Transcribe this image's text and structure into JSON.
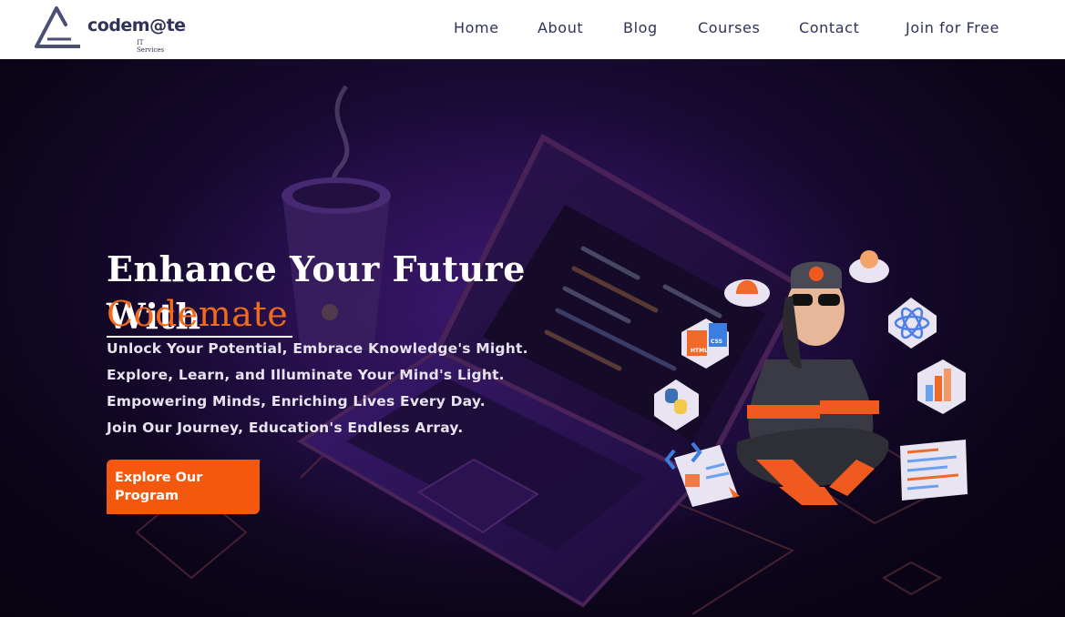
{
  "brand": {
    "name": "codem@te",
    "subtitle": "IT Services",
    "logo_icon": "triangle-logo-icon",
    "color": "#2f3357"
  },
  "nav": {
    "items": [
      {
        "label": "Home"
      },
      {
        "label": "About"
      },
      {
        "label": "Blog"
      },
      {
        "label": "Courses"
      },
      {
        "label": "Contact"
      },
      {
        "label": "Join for Free"
      }
    ]
  },
  "hero": {
    "title_line1": "Enhance Your Future With",
    "title_accent": "Codemate",
    "taglines": [
      "Unlock Your Potential, Embrace Knowledge's Might.",
      "Explore, Learn, and Illuminate Your Mind's Light.",
      "Empowering Minds, Enriching Lives Every Day.",
      "Join Our Journey, Education's Endless Array."
    ],
    "cta_label": "Explore Our Program",
    "accent_color": "#f26b1d",
    "cta_color": "#f4580f",
    "illustration": {
      "icons": [
        "coffee-cup-icon",
        "laptop-icon",
        "developer-avatar",
        "bell-icon",
        "lightbulb-icon",
        "atom-icon",
        "html-css-icon",
        "python-icon",
        "bar-chart-icon",
        "code-editor-icon",
        "code-document-icon"
      ],
      "badge_html": "HTML",
      "badge_css": "CSS"
    }
  }
}
